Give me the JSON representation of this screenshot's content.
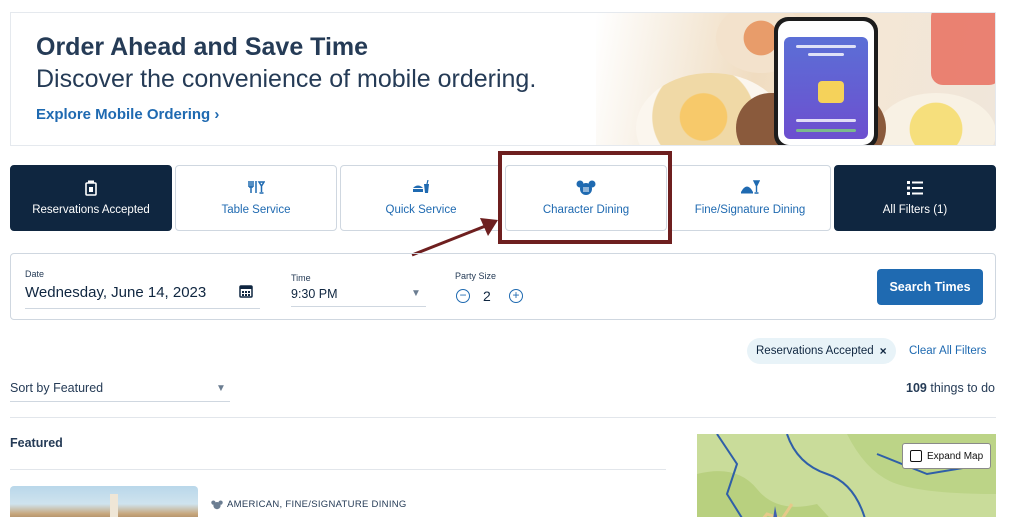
{
  "banner": {
    "title": "Order Ahead and Save Time",
    "subtitle": "Discover the convenience of mobile ordering.",
    "link": "Explore Mobile Ordering ›"
  },
  "filters": [
    {
      "label": "Reservations Accepted",
      "icon": "reservation-icon",
      "selected": true
    },
    {
      "label": "Table Service",
      "icon": "table-service-icon",
      "selected": false
    },
    {
      "label": "Quick Service",
      "icon": "quick-service-icon",
      "selected": false
    },
    {
      "label": "Character Dining",
      "icon": "mickey-icon",
      "selected": false,
      "highlighted": true
    },
    {
      "label": "Fine/Signature Dining",
      "icon": "fine-dining-icon",
      "selected": false
    },
    {
      "label": "All Filters  (1)",
      "icon": "filter-list-icon",
      "selected": true
    }
  ],
  "search": {
    "date_label": "Date",
    "date_value": "Wednesday, June 14, 2023",
    "time_label": "Time",
    "time_value": "9:30 PM",
    "party_label": "Party Size",
    "party_value": "2",
    "button": "Search Times"
  },
  "active_filters": {
    "chip": "Reservations Accepted",
    "clear": "Clear All Filters"
  },
  "sort": {
    "label": "Sort by Featured"
  },
  "results": {
    "count": "109",
    "suffix": " things to do"
  },
  "featured": {
    "title": "Featured",
    "card_tags": "AMERICAN, FINE/SIGNATURE DINING"
  },
  "map": {
    "expand": "Expand Map"
  },
  "colors": {
    "accent": "#1f6ab1",
    "dark_tile": "#0f2640",
    "highlight_box": "#6e1f1f"
  }
}
